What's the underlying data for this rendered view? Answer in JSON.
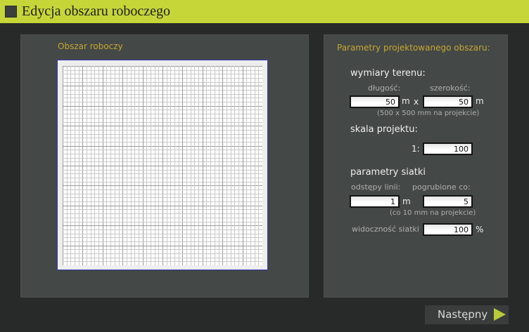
{
  "window": {
    "title": "Edycja obszaru roboczego"
  },
  "workspace": {
    "title": "Obszar roboczy"
  },
  "params": {
    "title": "Parametry projektowanego obszaru:",
    "terrain": {
      "heading": "wymiary terenu:",
      "length_label": "długość:",
      "width_label": "szerokość:",
      "length_value": "50",
      "width_value": "50",
      "unit": "m",
      "times": "x",
      "note": "(500 x 500 mm na projekcie)"
    },
    "scale": {
      "heading": "skala projektu:",
      "prefix": "1:",
      "value": "100"
    },
    "grid": {
      "heading": "parametry siatki",
      "spacing_label": "odstępy linii:",
      "bold_label": "pogrubione co:",
      "spacing_value": "1",
      "spacing_unit": "m",
      "bold_value": "5",
      "note": "(co 10 mm na projekcie)",
      "visibility_label": "widoczność siatki",
      "visibility_value": "100",
      "visibility_unit": "%"
    }
  },
  "footer": {
    "next_label": "Następny"
  },
  "colors": {
    "accent": "#c6d639",
    "background": "#272a28",
    "panel": "#444846",
    "panel_title": "#c6a732",
    "canvas_border": "#3a3ab0"
  },
  "icons": {
    "title": "square-icon",
    "next": "play-arrow-icon"
  }
}
